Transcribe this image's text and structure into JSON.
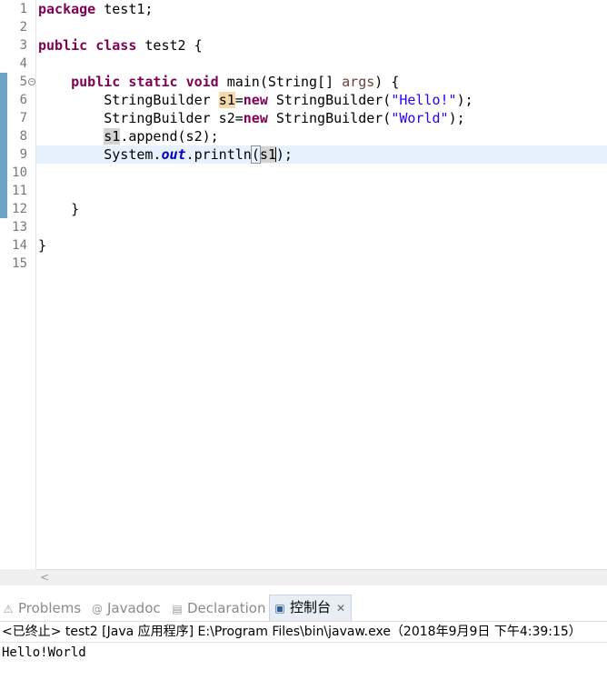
{
  "editor": {
    "line_numbers": [
      "1",
      "2",
      "3",
      "4",
      "5",
      "6",
      "7",
      "8",
      "9",
      "10",
      "11",
      "12",
      "13",
      "14",
      "15"
    ],
    "fold_glyph": "⊖",
    "code": {
      "l1_kw": "package",
      "l1_rest": " test1;",
      "l3_kw1": "public",
      "l3_kw2": "class",
      "l3_rest": " test2 {",
      "l5_indent": "    ",
      "l5_kw1": "public",
      "l5_kw2": "static",
      "l5_kw3": "void",
      "l5_mid": " main(String[] ",
      "l5_param": "args",
      "l5_end": ") {",
      "l6_pre": "        StringBuilder ",
      "l6_var": "s1",
      "l6_eq": "=",
      "l6_kw": "new",
      "l6_mid": " StringBuilder(",
      "l6_str": "\"Hello!\"",
      "l6_end": ");",
      "l7_pre": "        StringBuilder s2=",
      "l7_kw": "new",
      "l7_mid": " StringBuilder(",
      "l7_str": "\"World\"",
      "l7_end": ");",
      "l8_indent": "        ",
      "l8_var": "s1",
      "l8_rest": ".append(s2);",
      "l9_pre": "        System.",
      "l9_field": "out",
      "l9_mid": ".println",
      "l9_open": "(",
      "l9_var": "s1",
      "l9_end": ");",
      "l12": "    }",
      "l14": "}"
    },
    "scroll_left_arrow": "<"
  },
  "panel": {
    "tabs": [
      {
        "label": "Problems",
        "icon": "problems-icon",
        "glyph": "⚠",
        "active": false
      },
      {
        "label": "Javadoc",
        "icon": "javadoc-icon",
        "glyph": "@",
        "active": false
      },
      {
        "label": "Declaration",
        "icon": "declaration-icon",
        "glyph": "▤",
        "active": false
      },
      {
        "label": "控制台",
        "icon": "console-icon",
        "glyph": "▣",
        "active": true
      }
    ],
    "close_glyph": "✕",
    "status_line": "<已终止> test2 [Java 应用程序] E:\\Program Files\\bin\\javaw.exe（2018年9月9日 下午4:39:15）",
    "output": "Hello!World"
  },
  "colors": {
    "keyword": "#7f0055",
    "string": "#2a00ff",
    "static_field": "#0000c0",
    "current_line": "#e8f2fe",
    "change_bar": "#6fa3c8"
  }
}
